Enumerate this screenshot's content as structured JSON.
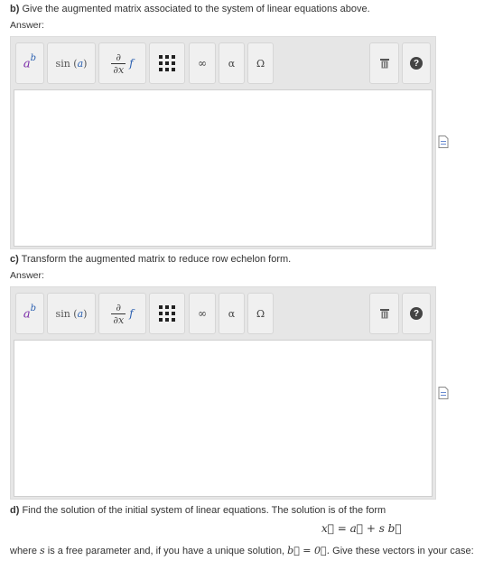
{
  "questions": {
    "b": {
      "label": "b)",
      "text": "Give the augmented matrix associated to the system of linear equations above.",
      "answer_label": "Answer:"
    },
    "c": {
      "label": "c)",
      "text": "Transform the augmented matrix to reduce row echelon form.",
      "answer_label": "Answer:"
    },
    "d": {
      "label": "d)",
      "text": "Find the solution of the initial system of linear equations. The solution is of the form",
      "formula": "x⃗ = a⃗ + s b⃗",
      "where_prefix": "where",
      "where_var": "s",
      "where_middle": "is a free parameter and, if you have a unique solution,",
      "where_eq": "b⃗ = 0⃗.",
      "where_suffix": "Give these vectors in your case:"
    }
  },
  "toolbar": {
    "power_base": "a",
    "power_exp": "b",
    "sin_label": "sin",
    "sin_arg": "a",
    "deriv_num": "∂",
    "deriv_den": "∂x",
    "deriv_fn": "f",
    "infinity": "∞",
    "alpha": "α",
    "omega": "Ω",
    "help": "?"
  },
  "colors": {
    "toolbar_bg": "#e6e6e6",
    "button_bg": "#f0f0f0",
    "accent_purple": "#7a2aa8",
    "accent_blue": "#2a5fb0"
  }
}
